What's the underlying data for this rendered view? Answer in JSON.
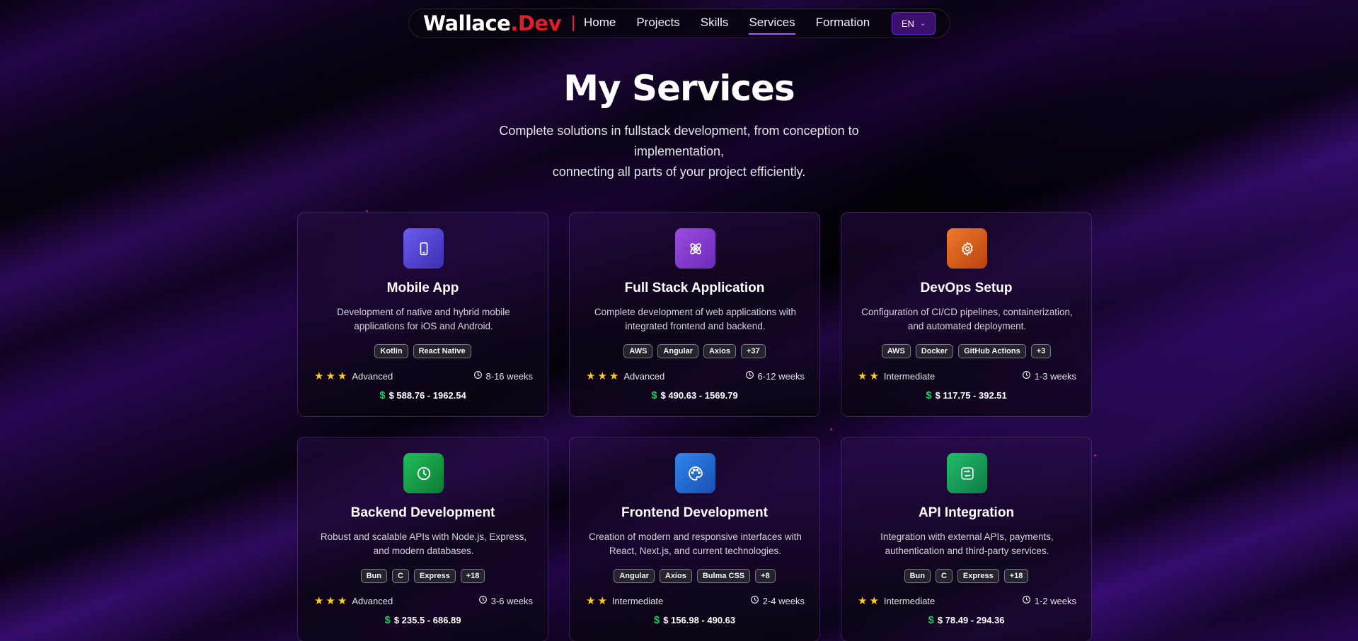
{
  "nav": {
    "logo_main": "Wallace",
    "logo_accent": ".Dev",
    "links": [
      "Home",
      "Projects",
      "Skills",
      "Services",
      "Formation"
    ],
    "active": "Services",
    "lang": "EN"
  },
  "hero": {
    "title": "My Services",
    "subtitle_line1": "Complete solutions in fullstack development, from conception to implementation,",
    "subtitle_line2": "connecting all parts of your project efficiently."
  },
  "colors": {
    "accent": "#a855f7",
    "logo_accent": "#e11d2a",
    "star": "#facc15",
    "dollar": "#22c55e"
  },
  "services": [
    {
      "icon": "smartphone-icon",
      "title": "Mobile App",
      "description": "Development of native and hybrid mobile applications for iOS and Android.",
      "tags": [
        "Kotlin",
        "React Native"
      ],
      "stars": 3,
      "level": "Advanced",
      "duration": "8-16 weeks",
      "price": "$ 588.76 - 1962.54"
    },
    {
      "icon": "atom-icon",
      "title": "Full Stack Application",
      "description": "Complete development of web applications with integrated frontend and backend.",
      "tags": [
        "AWS",
        "Angular",
        "Axios",
        "+37"
      ],
      "stars": 3,
      "level": "Advanced",
      "duration": "6-12 weeks",
      "price": "$ 490.63 - 1569.79"
    },
    {
      "icon": "gear-icon",
      "title": "DevOps Setup",
      "description": "Configuration of CI/CD pipelines, containerization, and automated deployment.",
      "tags": [
        "AWS",
        "Docker",
        "GitHub Actions",
        "+3"
      ],
      "stars": 2,
      "level": "Intermediate",
      "duration": "1-3 weeks",
      "price": "$ 117.75 - 392.51"
    },
    {
      "icon": "clock-icon",
      "title": "Backend Development",
      "description": "Robust and scalable APIs with Node.js, Express, and modern databases.",
      "tags": [
        "Bun",
        "C",
        "Express",
        "+18"
      ],
      "stars": 3,
      "level": "Advanced",
      "duration": "3-6 weeks",
      "price": "$ 235.5 - 686.89"
    },
    {
      "icon": "palette-icon",
      "title": "Frontend Development",
      "description": "Creation of modern and responsive interfaces with React, Next.js, and current technologies.",
      "tags": [
        "Angular",
        "Axios",
        "Bulma CSS",
        "+8"
      ],
      "stars": 2,
      "level": "Intermediate",
      "duration": "2-4 weeks",
      "price": "$ 156.98 - 490.63"
    },
    {
      "icon": "api-icon",
      "title": "API Integration",
      "description": "Integration with external APIs, payments, authentication and third-party services.",
      "tags": [
        "Bun",
        "C",
        "Express",
        "+18"
      ],
      "stars": 2,
      "level": "Intermediate",
      "duration": "1-2 weeks",
      "price": "$ 78.49 - 294.36"
    }
  ]
}
